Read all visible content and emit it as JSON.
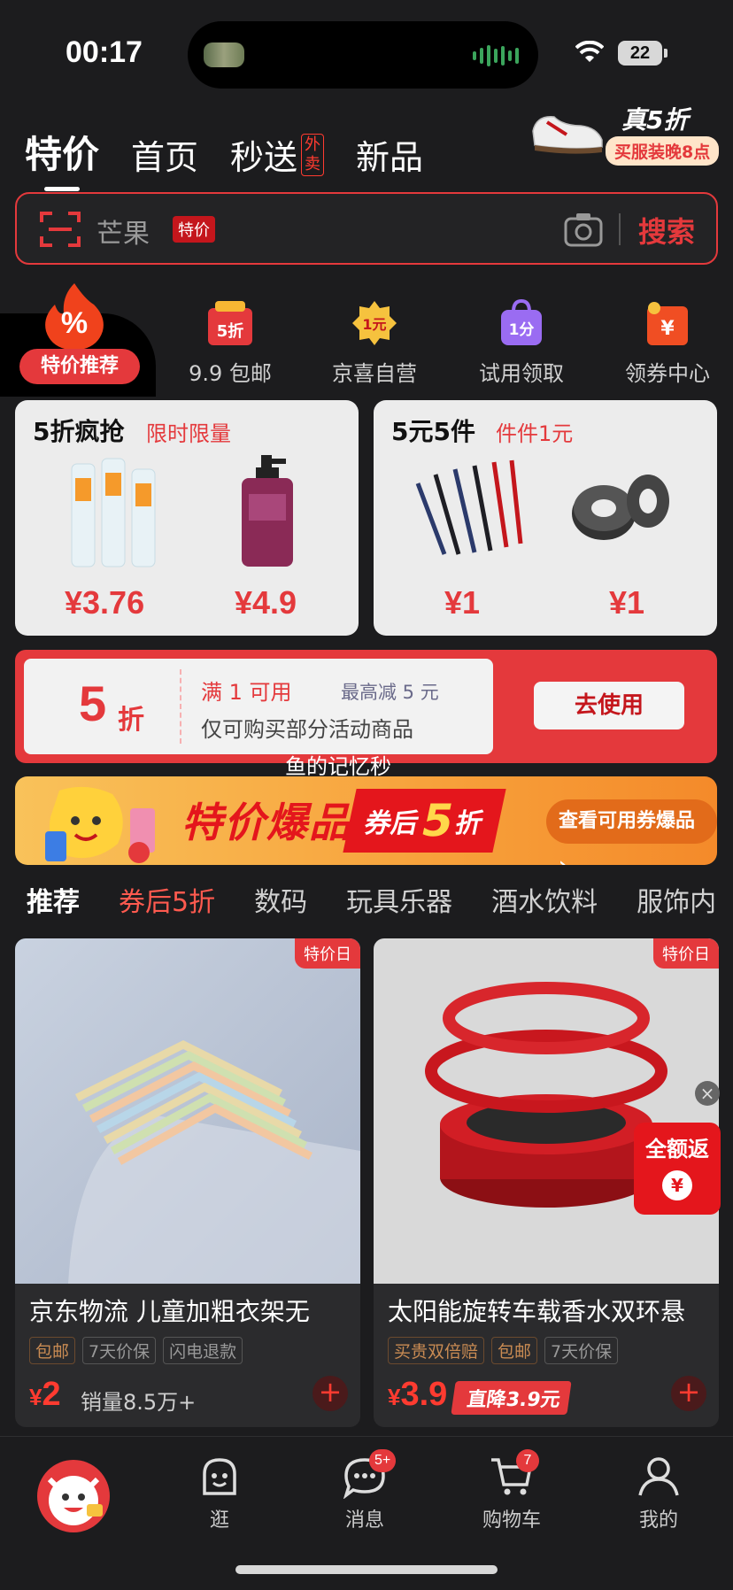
{
  "status": {
    "time": "00:17",
    "battery": "22"
  },
  "top_tabs": [
    {
      "label": "特价"
    },
    {
      "label": "首页"
    },
    {
      "label": "秒送",
      "tag": "外卖"
    },
    {
      "label": "新品"
    }
  ],
  "promo": {
    "title": "真5折",
    "subtitle": "买服装晚8点"
  },
  "search": {
    "placeholder": "芒果",
    "tag": "特价",
    "button": "搜索"
  },
  "categories": {
    "active": "特价推荐",
    "items": [
      {
        "label": "9.9 包邮",
        "icon": "5折"
      },
      {
        "label": "京喜自营",
        "icon": "1元"
      },
      {
        "label": "试用领取",
        "icon": "1分"
      },
      {
        "label": "领券中心",
        "icon": "¥"
      }
    ]
  },
  "deals": [
    {
      "title": "5折疯抢",
      "subtitle": "限时限量",
      "prices": [
        "¥3.76",
        "¥4.9"
      ]
    },
    {
      "title": "5元5件",
      "subtitle": "件件1元",
      "prices": [
        "¥1",
        "¥1"
      ]
    }
  ],
  "coupon": {
    "amount": "5",
    "unit": "折",
    "condition": "满 1 可用",
    "max": "最高减 5 元",
    "description": "仅可购买部分活动商品",
    "button": "去使用"
  },
  "watermark": "鱼的记忆秒",
  "banner": {
    "main": "特价爆品",
    "sub_a": "券后",
    "sub_b": "5",
    "sub_c": "折",
    "button": "查看可用券爆品 ›"
  },
  "cat_tabs": [
    "推荐",
    "券后5折",
    "数码",
    "玩具乐器",
    "酒水饮料",
    "服饰内"
  ],
  "products": [
    {
      "tag": "特价日",
      "name": "京东物流 儿童加粗衣架无",
      "tags": [
        "包邮",
        "7天价保",
        "闪电退款"
      ],
      "price_symbol": "¥",
      "price": "2",
      "sales": "销量8.5万+"
    },
    {
      "tag": "特价日",
      "name": "太阳能旋转车载香水双环悬",
      "tags": [
        "买贵双倍赔",
        "包邮",
        "7天价保"
      ],
      "price_symbol": "¥",
      "price": "3.9",
      "drop": "直降3.9元"
    }
  ],
  "float": {
    "refund": "全额返",
    "coin": "¥"
  },
  "nav": {
    "items": [
      {
        "label": "逛"
      },
      {
        "label": "消息",
        "badge": "5+"
      },
      {
        "label": "购物车",
        "badge": "7"
      },
      {
        "label": "我的"
      }
    ]
  },
  "colors": {
    "accent": "#e4393c",
    "background": "#1c1c1e"
  }
}
